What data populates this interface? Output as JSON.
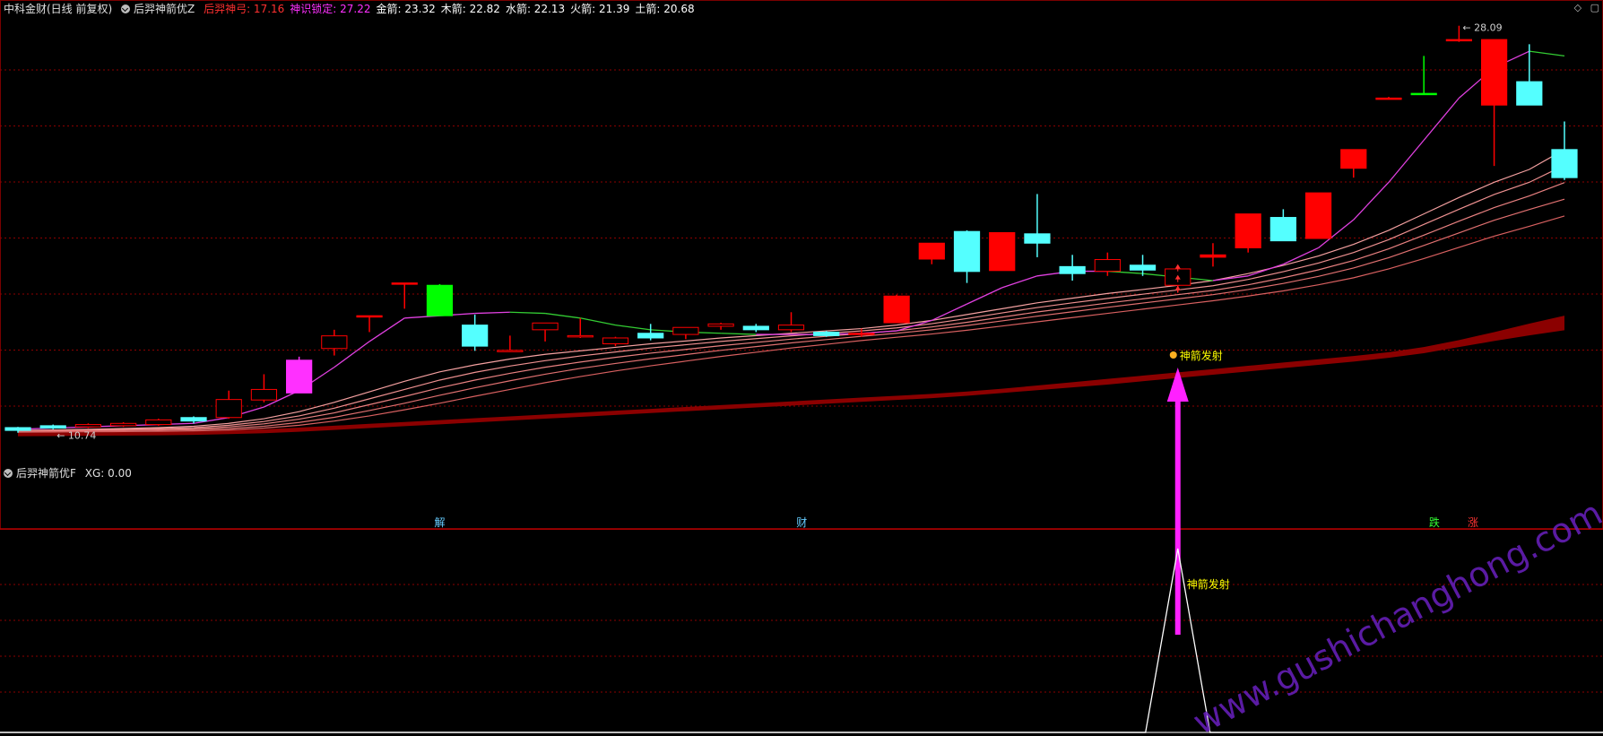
{
  "header": {
    "stock": "中科金财(日线 前复权)",
    "indicator": "后羿神箭优Z",
    "items": [
      {
        "label": "后羿神弓:",
        "value": "17.16",
        "color": "#ff3030"
      },
      {
        "label": "神识锁定:",
        "value": "27.22",
        "color": "#ff30ff"
      },
      {
        "label": "金箭:",
        "value": "23.32",
        "color": "#ffffff"
      },
      {
        "label": "木箭:",
        "value": "22.82",
        "color": "#ffffff"
      },
      {
        "label": "水箭:",
        "value": "22.13",
        "color": "#ffffff"
      },
      {
        "label": "火箭:",
        "value": "21.39",
        "color": "#ffffff"
      },
      {
        "label": "土箭:",
        "value": "20.68",
        "color": "#ffffff"
      }
    ],
    "corner_icons": [
      "diamond-icon",
      "window-icon"
    ]
  },
  "sub_header": {
    "indicator": "后羿神箭优F",
    "label": "XG:",
    "value": "0.00"
  },
  "annotations": {
    "high_label": "28.09",
    "low_label": "10.74",
    "signal_main": "神箭发射",
    "signal_sub": "神箭发射",
    "marks": [
      {
        "text": "解",
        "color": "#66ccff"
      },
      {
        "text": "财",
        "color": "#66ccff"
      },
      {
        "text": "跌",
        "color": "#33ff33"
      },
      {
        "text": "涨",
        "color": "#ff3333"
      }
    ],
    "watermark": "www.gushichanghong.com"
  },
  "colors": {
    "up": "#ff0000",
    "down": "#54ffff",
    "band": "#8b0000",
    "ma_rising": "#e040e0",
    "ma_falling": "#33cc33",
    "ribbon": "#f08080",
    "grid": "#8b0000",
    "arrow": "#ff20ff",
    "signal_text": "#ffff00"
  },
  "chart_data": {
    "type": "candlestick",
    "price_range": [
      10.0,
      28.5
    ],
    "candles": [
      {
        "o": 10.8,
        "c": 10.92,
        "h": 10.95,
        "l": 10.7,
        "color": "down"
      },
      {
        "o": 10.9,
        "c": 11.0,
        "h": 11.05,
        "l": 10.85,
        "color": "down"
      },
      {
        "o": 10.95,
        "c": 11.05,
        "h": 11.1,
        "l": 10.9,
        "color": "up"
      },
      {
        "o": 11.0,
        "c": 11.1,
        "h": 11.15,
        "l": 10.95,
        "color": "up"
      },
      {
        "o": 11.05,
        "c": 11.25,
        "h": 11.3,
        "l": 11.0,
        "color": "up"
      },
      {
        "o": 11.2,
        "c": 11.35,
        "h": 11.4,
        "l": 11.1,
        "color": "down"
      },
      {
        "o": 11.35,
        "c": 12.12,
        "h": 12.5,
        "l": 11.3,
        "color": "up"
      },
      {
        "o": 12.1,
        "c": 12.55,
        "h": 13.2,
        "l": 12.0,
        "color": "up"
      },
      {
        "o": 12.4,
        "c": 13.8,
        "h": 13.95,
        "l": 12.4,
        "color": "magenta"
      },
      {
        "o": 14.3,
        "c": 14.84,
        "h": 15.1,
        "l": 14.0,
        "color": "up"
      },
      {
        "o": 15.7,
        "c": 15.7,
        "h": 15.7,
        "l": 15.0,
        "color": "up"
      },
      {
        "o": 17.1,
        "c": 17.1,
        "h": 17.1,
        "l": 16.0,
        "color": "up"
      },
      {
        "o": 17.0,
        "c": 15.7,
        "h": 17.05,
        "l": 15.7,
        "color": "green"
      },
      {
        "o": 15.3,
        "c": 14.4,
        "h": 15.75,
        "l": 14.2,
        "color": "down"
      },
      {
        "o": 14.2,
        "c": 14.22,
        "h": 14.85,
        "l": 14.15,
        "color": "up"
      },
      {
        "o": 15.1,
        "c": 15.39,
        "h": 15.4,
        "l": 14.6,
        "color": "up"
      },
      {
        "o": 14.82,
        "c": 14.85,
        "h": 15.6,
        "l": 14.75,
        "color": "up"
      },
      {
        "o": 14.5,
        "c": 14.75,
        "h": 14.8,
        "l": 14.4,
        "color": "up"
      },
      {
        "o": 14.95,
        "c": 14.75,
        "h": 15.35,
        "l": 14.65,
        "color": "down"
      },
      {
        "o": 14.9,
        "c": 15.2,
        "h": 15.2,
        "l": 14.7,
        "color": "up"
      },
      {
        "o": 15.25,
        "c": 15.35,
        "h": 15.4,
        "l": 15.1,
        "color": "up"
      },
      {
        "o": 15.25,
        "c": 15.1,
        "h": 15.35,
        "l": 15.0,
        "color": "down"
      },
      {
        "o": 15.1,
        "c": 15.3,
        "h": 15.85,
        "l": 15.0,
        "color": "up"
      },
      {
        "o": 15.0,
        "c": 14.85,
        "h": 15.05,
        "l": 14.8,
        "color": "down"
      },
      {
        "o": 14.95,
        "c": 14.9,
        "h": 15.15,
        "l": 14.8,
        "color": "up"
      },
      {
        "o": 15.4,
        "c": 16.54,
        "h": 16.6,
        "l": 15.4,
        "color": "up"
      },
      {
        "o": 18.12,
        "c": 18.8,
        "h": 18.8,
        "l": 17.9,
        "color": "up"
      },
      {
        "o": 19.3,
        "c": 17.59,
        "h": 19.35,
        "l": 17.1,
        "color": "down"
      },
      {
        "o": 17.63,
        "c": 19.25,
        "h": 19.25,
        "l": 17.63,
        "color": "up"
      },
      {
        "o": 19.2,
        "c": 18.8,
        "h": 20.9,
        "l": 18.2,
        "color": "down"
      },
      {
        "o": 17.8,
        "c": 17.5,
        "h": 18.3,
        "l": 17.2,
        "color": "down"
      },
      {
        "o": 17.6,
        "c": 18.1,
        "h": 18.4,
        "l": 17.4,
        "color": "up"
      },
      {
        "o": 17.86,
        "c": 17.65,
        "h": 18.3,
        "l": 17.4,
        "color": "down"
      },
      {
        "o": 17.0,
        "c": 17.7,
        "h": 17.85,
        "l": 16.7,
        "color": "up"
      },
      {
        "o": 18.2,
        "c": 18.3,
        "h": 18.8,
        "l": 17.8,
        "color": "up"
      },
      {
        "o": 18.6,
        "c": 20.05,
        "h": 20.05,
        "l": 18.4,
        "color": "up"
      },
      {
        "o": 18.9,
        "c": 19.9,
        "h": 20.25,
        "l": 18.9,
        "color": "down"
      },
      {
        "o": 19.0,
        "c": 20.95,
        "h": 20.95,
        "l": 19.0,
        "color": "up"
      },
      {
        "o": 22.0,
        "c": 22.8,
        "h": 22.8,
        "l": 21.6,
        "color": "up"
      },
      {
        "o": 25.0,
        "c": 25.0,
        "h": 25.05,
        "l": 24.95,
        "color": "up"
      },
      {
        "o": 25.2,
        "c": 25.2,
        "h": 26.8,
        "l": 25.2,
        "color": "green"
      },
      {
        "o": 27.5,
        "c": 27.5,
        "h": 28.09,
        "l": 27.4,
        "color": "up"
      },
      {
        "o": 24.7,
        "c": 27.5,
        "h": 27.5,
        "l": 22.1,
        "color": "up"
      },
      {
        "o": 25.7,
        "c": 24.7,
        "h": 27.3,
        "l": 24.7,
        "color": "down"
      },
      {
        "o": 22.8,
        "c": 21.6,
        "h": 24.0,
        "l": 21.5,
        "color": "down"
      }
    ],
    "ma": [
      10.85,
      10.9,
      10.95,
      11.0,
      11.05,
      11.1,
      11.35,
      11.8,
      12.5,
      13.5,
      14.6,
      15.6,
      15.7,
      15.8,
      15.85,
      15.8,
      15.6,
      15.3,
      15.1,
      15.0,
      14.95,
      14.9,
      14.9,
      14.9,
      14.95,
      15.05,
      15.5,
      16.2,
      16.9,
      17.4,
      17.6,
      17.6,
      17.5,
      17.35,
      17.2,
      17.4,
      17.9,
      18.6,
      19.8,
      21.4,
      23.2,
      25.0,
      26.3,
      27.0,
      26.8
    ],
    "ribbon": [
      [
        10.8,
        10.82,
        10.85,
        10.88,
        10.92,
        10.98,
        11.1,
        11.3,
        11.6,
        12.0,
        12.45,
        12.9,
        13.3,
        13.6,
        13.85,
        14.05,
        14.2,
        14.35,
        14.5,
        14.62,
        14.75,
        14.85,
        14.95,
        15.05,
        15.15,
        15.3,
        15.5,
        15.75,
        16.0,
        16.25,
        16.45,
        16.65,
        16.82,
        17.0,
        17.2,
        17.5,
        17.85,
        18.25,
        18.75,
        19.35,
        20.05,
        20.75,
        21.4,
        21.95,
        22.8
      ],
      [
        10.78,
        10.8,
        10.82,
        10.85,
        10.88,
        10.92,
        11.02,
        11.18,
        11.42,
        11.75,
        12.15,
        12.55,
        12.95,
        13.28,
        13.55,
        13.78,
        13.98,
        14.15,
        14.32,
        14.46,
        14.6,
        14.72,
        14.84,
        14.95,
        15.05,
        15.18,
        15.36,
        15.58,
        15.82,
        16.05,
        16.25,
        16.44,
        16.62,
        16.8,
        16.98,
        17.25,
        17.58,
        17.95,
        18.4,
        18.95,
        19.6,
        20.25,
        20.88,
        21.4,
        22.13
      ],
      [
        10.76,
        10.78,
        10.8,
        10.82,
        10.84,
        10.87,
        10.95,
        11.08,
        11.28,
        11.55,
        11.9,
        12.25,
        12.62,
        12.95,
        13.24,
        13.5,
        13.72,
        13.92,
        14.1,
        14.26,
        14.42,
        14.56,
        14.7,
        14.82,
        14.94,
        15.06,
        15.22,
        15.42,
        15.64,
        15.86,
        16.05,
        16.24,
        16.42,
        16.6,
        16.78,
        17.02,
        17.32,
        17.66,
        18.06,
        18.56,
        19.14,
        19.74,
        20.32,
        20.82,
        21.39
      ],
      [
        10.74,
        10.76,
        10.77,
        10.79,
        10.81,
        10.83,
        10.88,
        10.98,
        11.14,
        11.36,
        11.65,
        11.96,
        12.3,
        12.62,
        12.92,
        13.2,
        13.45,
        13.66,
        13.86,
        14.04,
        14.22,
        14.38,
        14.54,
        14.68,
        14.82,
        14.95,
        15.1,
        15.28,
        15.48,
        15.68,
        15.87,
        16.06,
        16.24,
        16.42,
        16.6,
        16.82,
        17.08,
        17.38,
        17.74,
        18.18,
        18.7,
        19.24,
        19.78,
        20.24,
        20.68
      ],
      [
        10.72,
        10.73,
        10.74,
        10.75,
        10.76,
        10.78,
        10.82,
        10.9,
        11.02,
        11.2,
        11.42,
        11.68,
        11.96,
        12.26,
        12.55,
        12.84,
        13.1,
        13.34,
        13.56,
        13.76,
        13.96,
        14.14,
        14.32,
        14.48,
        14.64,
        14.78,
        14.92,
        15.08,
        15.26,
        15.44,
        15.62,
        15.8,
        15.98,
        16.16,
        16.34,
        16.54,
        16.76,
        17.02,
        17.32,
        17.7,
        18.14,
        18.62,
        19.1,
        19.52,
        19.96
      ]
    ],
    "band_top": [
      10.7,
      10.71,
      10.72,
      10.73,
      10.74,
      10.76,
      10.8,
      10.85,
      10.92,
      11.0,
      11.08,
      11.16,
      11.24,
      11.32,
      11.4,
      11.48,
      11.56,
      11.64,
      11.72,
      11.8,
      11.88,
      11.96,
      12.04,
      12.12,
      12.2,
      12.28,
      12.36,
      12.46,
      12.58,
      12.72,
      12.86,
      13.0,
      13.14,
      13.28,
      13.42,
      13.56,
      13.7,
      13.84,
      13.98,
      14.14,
      14.36,
      14.66,
      15.0,
      15.36,
      15.7
    ],
    "band_bottom": [
      10.55,
      10.56,
      10.57,
      10.58,
      10.59,
      10.61,
      10.64,
      10.68,
      10.74,
      10.82,
      10.9,
      10.98,
      11.06,
      11.14,
      11.22,
      11.3,
      11.38,
      11.46,
      11.54,
      11.62,
      11.7,
      11.78,
      11.86,
      11.94,
      12.02,
      12.1,
      12.18,
      12.28,
      12.4,
      12.52,
      12.64,
      12.76,
      12.9,
      13.04,
      13.18,
      13.32,
      13.46,
      13.6,
      13.74,
      13.9,
      14.1,
      14.36,
      14.62,
      14.86,
      15.08
    ],
    "signal_index": 33,
    "xg_peak_index": 33,
    "xg_values_note": "0 except a spike to 1 at signal index"
  }
}
